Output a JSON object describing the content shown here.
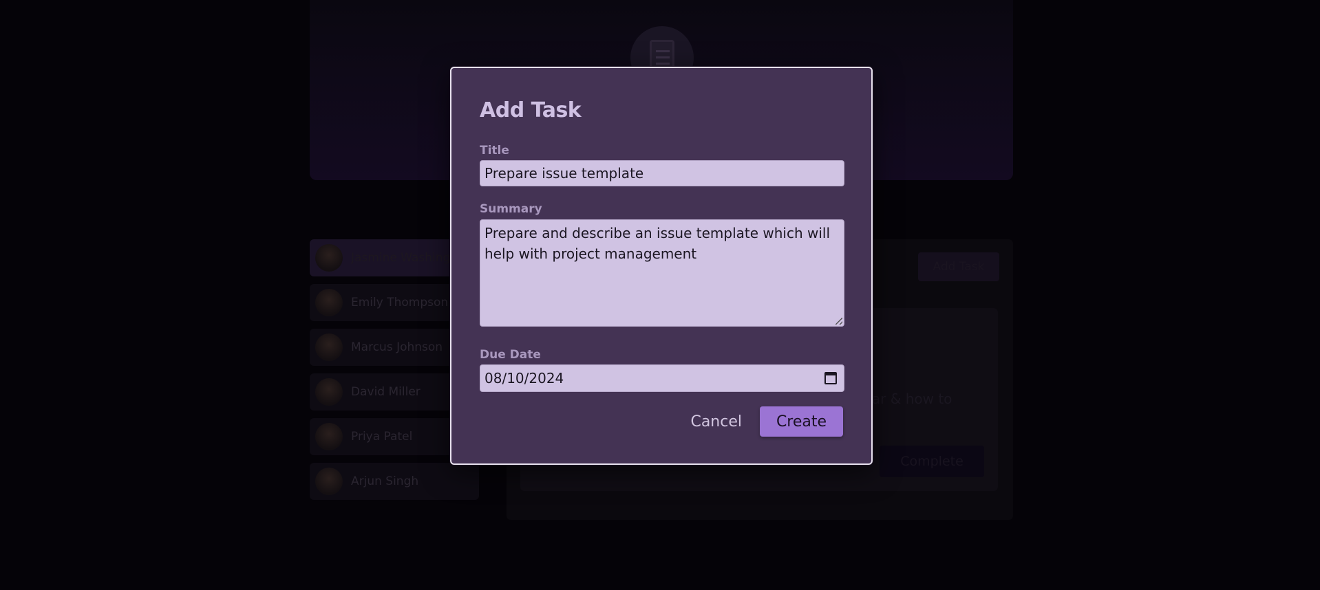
{
  "background": {
    "users": [
      {
        "name": "Jasmine Washington",
        "active": true
      },
      {
        "name": "Emily Thompson",
        "active": false
      },
      {
        "name": "Marcus Johnson",
        "active": false
      },
      {
        "name": "David Miller",
        "active": false
      },
      {
        "name": "Priya Patel",
        "active": false
      },
      {
        "name": "Arjun Singh",
        "active": false
      }
    ],
    "add_task_label": "Add Task",
    "task_text_fragment": "gular & how to",
    "complete_label": "Complete"
  },
  "modal": {
    "title": "Add Task",
    "title_label": "Title",
    "title_value": "Prepare issue template",
    "summary_label": "Summary",
    "summary_value": "Prepare and describe an issue template which will help with project management",
    "due_label": "Due Date",
    "due_value": "08/10/2024",
    "cancel_label": "Cancel",
    "create_label": "Create"
  },
  "colors": {
    "modal_bg": "#443354",
    "field_bg": "#d0c3e3",
    "accent": "#9b74d4",
    "title_text": "#cfc0e3"
  }
}
